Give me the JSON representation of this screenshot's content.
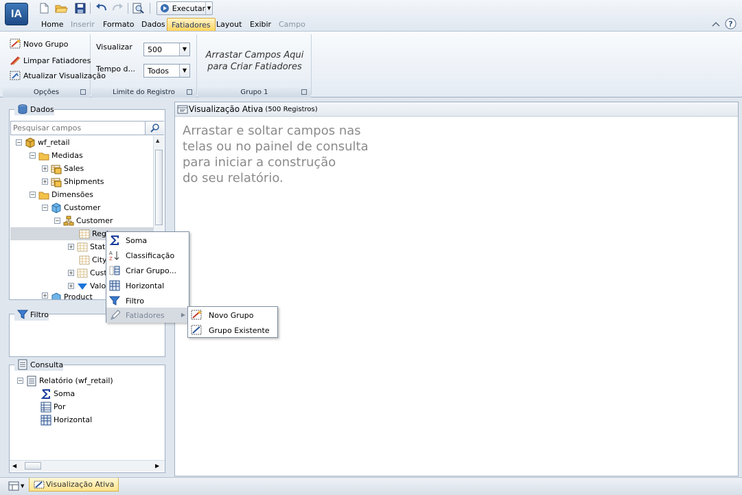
{
  "app": {
    "logo_text": "IA",
    "execute_label": "Executar"
  },
  "menu_tabs": [
    {
      "label": "Home",
      "state": "normal"
    },
    {
      "label": "Inserir",
      "state": "disabled"
    },
    {
      "label": "Formato",
      "state": "normal"
    },
    {
      "label": "Dados",
      "state": "normal"
    },
    {
      "label": "Fatiadores",
      "state": "active"
    },
    {
      "label": "Layout",
      "state": "normal"
    },
    {
      "label": "Exibir",
      "state": "normal"
    },
    {
      "label": "Campo",
      "state": "disabled"
    }
  ],
  "ribbon": {
    "options": {
      "new_group": "Novo Grupo",
      "clear_slicers": "Limpar Fatiadores",
      "refresh_view": "Atualizar Visualização",
      "footer": "Opções"
    },
    "record_limit": {
      "view_label": "Visualizar",
      "view_value": "500",
      "time_label": "Tempo d...",
      "time_value": "Todos",
      "footer": "Limite do Registro"
    },
    "group1": {
      "drop_hint_line1": "Arrastar Campos Aqui",
      "drop_hint_line2": "para Criar Fatiadores",
      "footer": "Grupo 1"
    }
  },
  "data_panel": {
    "title": "Dados",
    "search_placeholder": "Pesquisar campos",
    "tree": {
      "root": "wf_retail",
      "measures": "Medidas",
      "sales": "Sales",
      "shipments": "Shipments",
      "dimensions": "Dimensões",
      "customer_dim": "Customer",
      "customer_hier": "Customer",
      "region": "Regi",
      "state": "Stat",
      "city": "City",
      "cust": "Cust",
      "valo": "Valo",
      "product": "Product"
    }
  },
  "filter_panel": {
    "title": "Filtro"
  },
  "query_panel": {
    "title": "Consulta",
    "report": "Relatório (wf_retail)",
    "sum": "Soma",
    "by": "Por",
    "horizontal": "Horizontal"
  },
  "main": {
    "title": "Visualização Ativa",
    "records": "(500 Registros)",
    "instructions": [
      "Arrastar e soltar campos nas",
      "telas ou no painel de consulta",
      "para iniciar a construção",
      "do seu relatório."
    ]
  },
  "context_menu": {
    "items": [
      "Soma",
      "Classificação",
      "Criar Grupo...",
      "Horizontal",
      "Filtro",
      "Fatiadores"
    ],
    "submenu": [
      "Novo Grupo",
      "Grupo Existente"
    ]
  },
  "status_bar": {
    "tab_label": "Visualização Ativa"
  },
  "colors": {
    "accent_tab": "#ffd55c",
    "instruction_text": "#8b8b8b",
    "sigma_blue": "#1a3d9c"
  }
}
